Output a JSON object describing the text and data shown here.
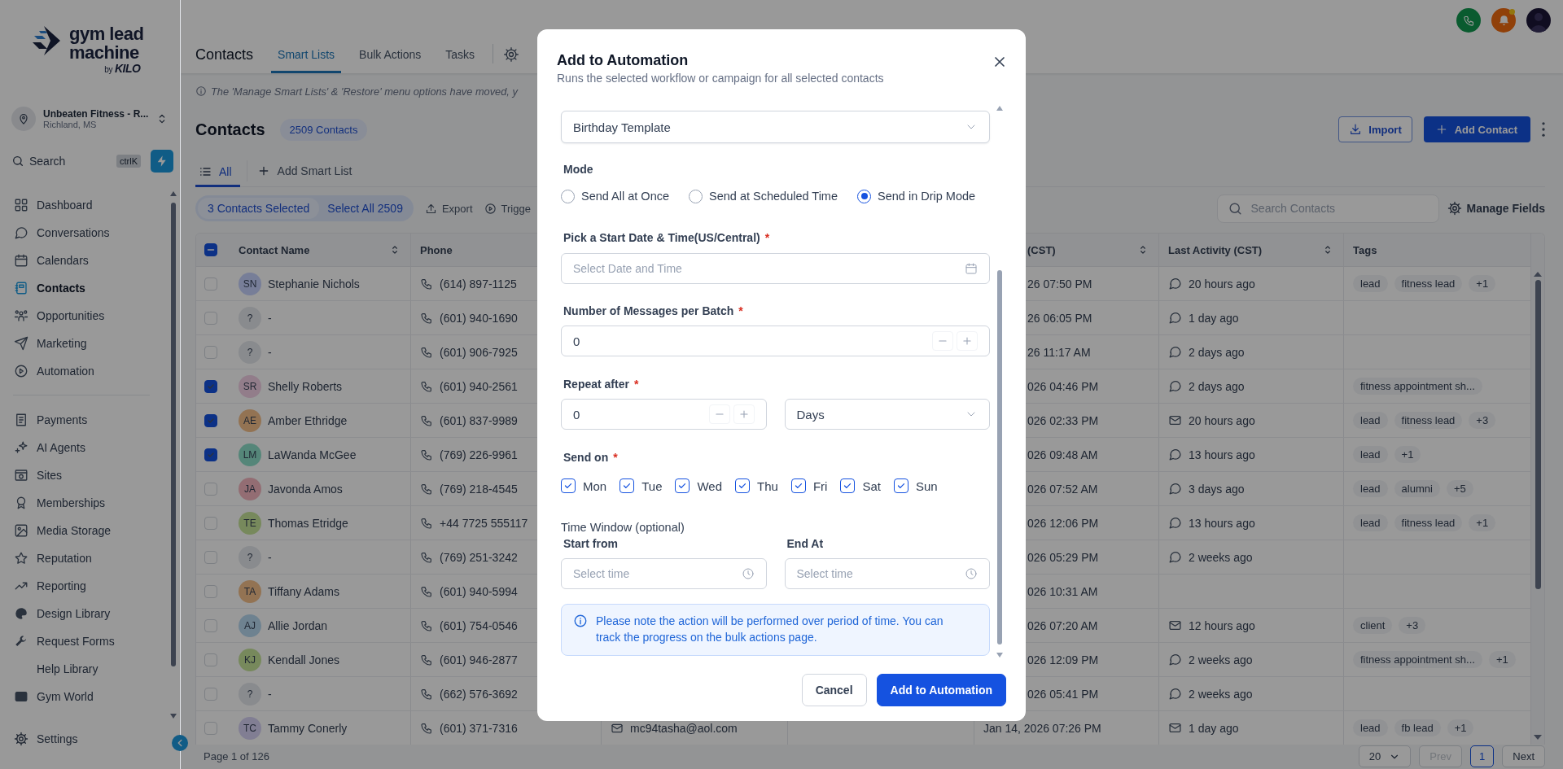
{
  "sidebar": {
    "logo": {
      "line_1": "gym lead",
      "line_2": "machine",
      "byline": "by",
      "brand": "KILO"
    },
    "account": {
      "name": "Unbeaten Fitness - R...",
      "location": "Richland, MS"
    },
    "search": {
      "label": "Search",
      "shortcut": "ctrlK"
    },
    "nav_main": [
      {
        "label": "Dashboard",
        "kind": "dashboard",
        "selected": false
      },
      {
        "label": "Conversations",
        "kind": "chat",
        "selected": false
      },
      {
        "label": "Calendars",
        "kind": "calendar",
        "selected": false
      },
      {
        "label": "Contacts",
        "kind": "contacts",
        "selected": true
      },
      {
        "label": "Opportunities",
        "kind": "opportunities",
        "selected": false
      },
      {
        "label": "Marketing",
        "kind": "send",
        "selected": false
      },
      {
        "label": "Automation",
        "kind": "automation",
        "selected": false
      }
    ],
    "nav_more": [
      {
        "label": "Payments",
        "kind": "payments",
        "selected": false
      },
      {
        "label": "AI Agents",
        "kind": "ai",
        "selected": false
      },
      {
        "label": "Sites",
        "kind": "sites",
        "selected": false
      },
      {
        "label": "Memberships",
        "kind": "memberships",
        "selected": false
      },
      {
        "label": "Media Storage",
        "kind": "media",
        "selected": false
      },
      {
        "label": "Reputation",
        "kind": "star",
        "selected": false
      },
      {
        "label": "Reporting",
        "kind": "reporting",
        "selected": false
      },
      {
        "label": "Design Library",
        "kind": "palette",
        "selected": false
      },
      {
        "label": "Request Forms",
        "kind": "wrench",
        "selected": false
      },
      {
        "label": "Help Library",
        "kind": "none",
        "selected": false
      },
      {
        "label": "Gym World",
        "kind": "screen",
        "selected": false
      }
    ],
    "settings": {
      "label": "Settings"
    }
  },
  "header": {
    "title": "Contacts",
    "tabs": [
      {
        "label": "Smart Lists",
        "selected": true
      },
      {
        "label": "Bulk Actions",
        "selected": false
      },
      {
        "label": "Tasks",
        "selected": false
      }
    ],
    "bell": {
      "unread": true
    }
  },
  "notice": "The 'Manage Smart Lists' & 'Restore' menu options have moved, y",
  "page": {
    "title": "Contacts",
    "count": "2509 Contacts",
    "import": "Import",
    "add": "Add Contact"
  },
  "list_tabs": [
    {
      "label": "All",
      "kind": "list",
      "selected": true
    },
    {
      "label": "Add Smart List",
      "kind": "add",
      "selected": false
    }
  ],
  "selection": {
    "selected": "3 Contacts Selected",
    "select_all": "Select All 2509",
    "actions": [
      {
        "label": "Export",
        "kind": "export"
      },
      {
        "label": "Trigge",
        "kind": "trigger"
      }
    ]
  },
  "search": {
    "placeholder": "Search Contacts"
  },
  "manage_fields": "Manage Fields",
  "table": {
    "select_all": {
      "indeterminate": true
    },
    "columns": [
      {
        "label": "Contact Name",
        "sortable": true
      },
      {
        "label": "Phone"
      },
      {
        "label": "(CST)",
        "sortable": true
      },
      {
        "label": "Last Activity (CST)",
        "sortable": true
      },
      {
        "label": "Tags",
        "sortable": false
      }
    ],
    "rows": [
      {
        "checked": false,
        "initials": "SN",
        "color": "#777e98",
        "name": "Stephanie Nichols",
        "phone": "(614) 897-1125",
        "date": "26 07:50 PM",
        "date_covered": true,
        "activity": {
          "kind": "chat",
          "text": "20 hours ago"
        },
        "tags": [
          "lead",
          "fitness lead",
          "+1"
        ]
      },
      {
        "checked": false,
        "initials": "?",
        "color": "#898b8e",
        "name": "-",
        "phone": "(601) 940-1690",
        "date": "26 06:05 PM",
        "date_covered": true,
        "activity": {
          "kind": "chat",
          "text": "1 day ago"
        }
      },
      {
        "checked": false,
        "initials": "?",
        "color": "#898b8e",
        "name": "-",
        "phone": "(601) 906-7925",
        "date": "26 11:17 AM",
        "date_covered": true,
        "activity": {
          "kind": "chat",
          "text": "2 days ago"
        }
      },
      {
        "checked": true,
        "initials": "SR",
        "color": "#927d8a",
        "name": "Shelly Roberts",
        "phone": "(601) 940-2561",
        "date": "026 04:46 PM",
        "date_covered": true,
        "activity": {
          "kind": "chat",
          "text": "2 days ago"
        },
        "tags": [
          "fitness appointment sh..."
        ]
      },
      {
        "checked": true,
        "initials": "AE",
        "color": "#937353",
        "name": "Amber Ethridge",
        "phone": "(601) 837-9989",
        "date": "026 02:33 PM",
        "date_covered": true,
        "activity": {
          "kind": "email",
          "text": "20 hours ago"
        },
        "tags": [
          "lead",
          "fitness lead",
          "+3"
        ]
      },
      {
        "checked": true,
        "initials": "LM",
        "color": "#558679",
        "name": "LaWanda McGee",
        "phone": "(769) 226-9961",
        "date": "026 09:48 AM",
        "date_covered": true,
        "activity": {
          "kind": "chat",
          "text": "13 hours ago"
        },
        "tags": [
          "lead",
          "+1"
        ]
      },
      {
        "checked": false,
        "initials": "JA",
        "color": "#936d73",
        "name": "Javonda Amos",
        "phone": "(769) 218-4545",
        "date": "026 07:52 AM",
        "date_covered": true,
        "activity": {
          "kind": "chat",
          "text": "3 days ago"
        },
        "tags": [
          "lead",
          "alumni",
          "+5"
        ]
      },
      {
        "checked": false,
        "initials": "TE",
        "color": "#77895c",
        "name": "Thomas Etridge",
        "phone": "+44 7725 555117",
        "date": "026 12:06 PM",
        "date_covered": true,
        "activity": {
          "kind": "chat",
          "text": "13 hours ago"
        },
        "tags": [
          "lead",
          "fitness lead",
          "+1"
        ]
      },
      {
        "checked": false,
        "initials": "?",
        "color": "#898b8e",
        "name": "-",
        "phone": "(769) 251-3242",
        "date": "026 05:29 PM",
        "date_covered": true,
        "activity": {
          "kind": "chat",
          "text": "2 weeks ago"
        }
      },
      {
        "checked": false,
        "initials": "TA",
        "color": "#937353",
        "name": "Tiffany Adams",
        "phone": "(601) 940-5994",
        "date": "026 10:31 AM",
        "date_covered": true
      },
      {
        "checked": false,
        "initials": "AJ",
        "color": "#6e8290",
        "name": "Allie Jordan",
        "phone": "(601) 754-0546",
        "date": "026 07:20 AM",
        "date_covered": true,
        "activity": {
          "kind": "email",
          "text": "12 hours ago"
        },
        "tags": [
          "client",
          "+3"
        ]
      },
      {
        "checked": false,
        "initials": "KJ",
        "color": "#77895c",
        "name": "Kendall Jones",
        "phone": "(601) 946-2877",
        "date": "026 12:09 PM",
        "date_covered": true,
        "activity": {
          "kind": "chat",
          "text": "2 weeks ago"
        },
        "tags": [
          "fitness appointment sh...",
          "+1"
        ]
      },
      {
        "checked": false,
        "initials": "?",
        "color": "#898b8e",
        "name": "-",
        "phone": "(662) 576-3692",
        "date": "026 05:41 PM",
        "date_covered": true,
        "activity": {
          "kind": "chat",
          "text": "2 weeks ago"
        }
      },
      {
        "checked": false,
        "initials": "TC",
        "color": "#817e93",
        "name": "Tammy Conerly",
        "phone": "(601) 371-7316",
        "email": "mc94tasha@aol.com",
        "date": "Jan 14, 2026 07:26 PM",
        "activity": {
          "kind": "email",
          "text": "1 day ago"
        },
        "tags": [
          "lead",
          "fb lead",
          "+1"
        ]
      }
    ]
  },
  "pagination": {
    "page_label": "Page 1 of 126",
    "page_size": "20",
    "prev": {
      "label": "Prev",
      "disabled": true
    },
    "pages": [
      {
        "label": "1",
        "selected": true
      }
    ],
    "next": {
      "label": "Next",
      "disabled": false
    }
  },
  "dialog": {
    "title": "Add to Automation",
    "subtitle": "Runs the selected workflow or campaign for all selected contacts",
    "workflow": {
      "value": "Birthday Template"
    },
    "mode": {
      "label": "Mode",
      "options": [
        {
          "label": "Send All at Once",
          "selected": false
        },
        {
          "label": "Send at Scheduled Time",
          "selected": false
        },
        {
          "label": "Send in Drip Mode",
          "selected": true
        }
      ]
    },
    "start": {
      "label": "Pick a Start Date & Time(US/Central)",
      "required_mark": "*",
      "placeholder": "Select Date and Time"
    },
    "batch": {
      "label": "Number of Messages per Batch",
      "required_mark": "*",
      "value": "0"
    },
    "repeat": {
      "label": "Repeat after",
      "required_mark": "*",
      "value": "0",
      "unit": "Days"
    },
    "send_on": {
      "label": "Send on",
      "required_mark": "*",
      "days": [
        {
          "label": "Mon",
          "checked": true
        },
        {
          "label": "Tue",
          "checked": true
        },
        {
          "label": "Wed",
          "checked": true
        },
        {
          "label": "Thu",
          "checked": true
        },
        {
          "label": "Fri",
          "checked": true
        },
        {
          "label": "Sat",
          "checked": true
        },
        {
          "label": "Sun",
          "checked": true
        }
      ]
    },
    "time_window": {
      "label": "Time Window (optional)",
      "start": {
        "label": "Start from",
        "placeholder": "Select time"
      },
      "end": {
        "label": "End At",
        "placeholder": "Select time"
      }
    },
    "note": "Please note the action will be performed over period of time. You can track the progress on the bulk actions page.",
    "buttons": [
      {
        "label": "Cancel",
        "kind": "secondary"
      },
      {
        "label": "Add to Automation",
        "kind": "primary"
      }
    ]
  }
}
